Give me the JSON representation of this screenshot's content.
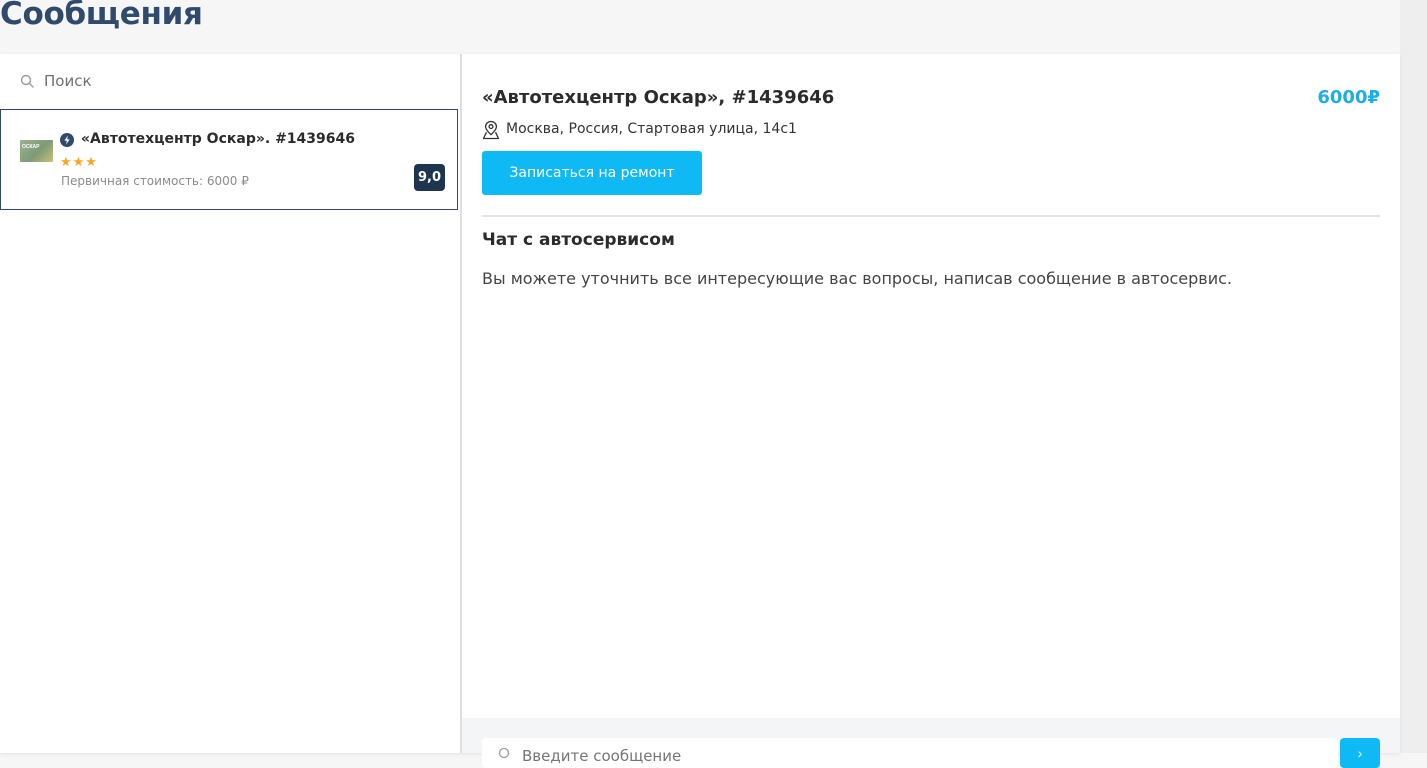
{
  "page": {
    "title": "Сообщения"
  },
  "sidebar": {
    "search": {
      "placeholder": "Поиск",
      "icon": "search-icon"
    },
    "conversations": [
      {
        "avatar_text": "ОСКАР",
        "title": "«Автотехцентр Оскар». #1439646",
        "stars": "★★★",
        "rating_stars": 3,
        "cost": "Первичная стоимость: 6000 ₽",
        "rating": "9,0",
        "icon": "bolt-icon"
      }
    ]
  },
  "main": {
    "service_title": "«Автотехцентр Оскар», #1439646",
    "price": "6000₽",
    "address": "Москва, Россия, Стартовая улица, 14с1",
    "book_button": "Записаться на ремонт",
    "chat_heading": "Чат с автосервисом",
    "chat_info": "Вы можете уточнить все интересующие вас вопросы, написав сообщение в автосервис.",
    "composer": {
      "placeholder": "Введите сообщение",
      "send_icon": "arrow-right-icon"
    }
  },
  "colors": {
    "title": "#2f4a6b",
    "accent": "#0fb9f4",
    "price": "#1eaee6",
    "badge": "#1e3550",
    "stars": "#f5a623"
  }
}
